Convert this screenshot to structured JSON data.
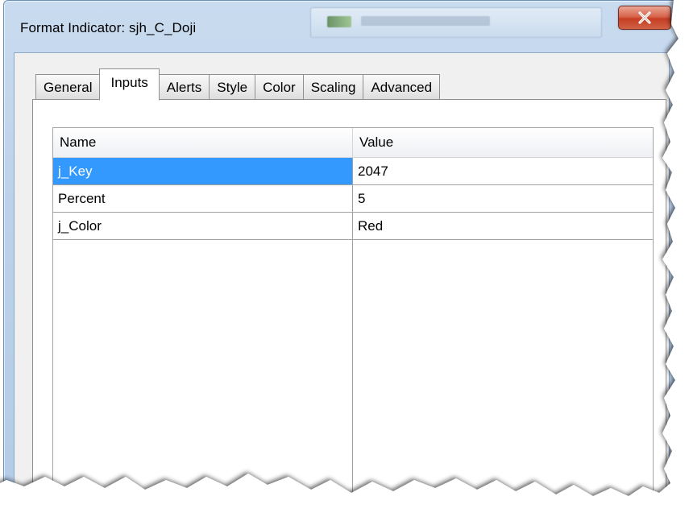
{
  "window": {
    "title": "Format Indicator: sjh_C_Doji",
    "close_glyph": "x"
  },
  "tabs": [
    {
      "label": "General",
      "active": false
    },
    {
      "label": "Inputs",
      "active": true
    },
    {
      "label": "Alerts",
      "active": false
    },
    {
      "label": "Style",
      "active": false
    },
    {
      "label": "Color",
      "active": false
    },
    {
      "label": "Scaling",
      "active": false
    },
    {
      "label": "Advanced",
      "active": false
    }
  ],
  "grid": {
    "columns": {
      "name": "Name",
      "value": "Value"
    },
    "rows": [
      {
        "name": "j_Key",
        "value": "2047",
        "selected": true
      },
      {
        "name": "Percent",
        "value": "5",
        "selected": false
      },
      {
        "name": "j_Color",
        "value": "Red",
        "selected": false
      }
    ]
  },
  "colors": {
    "selection": "#3399ff",
    "close_button": "#c63e23",
    "frame": "#bcd2ea"
  }
}
